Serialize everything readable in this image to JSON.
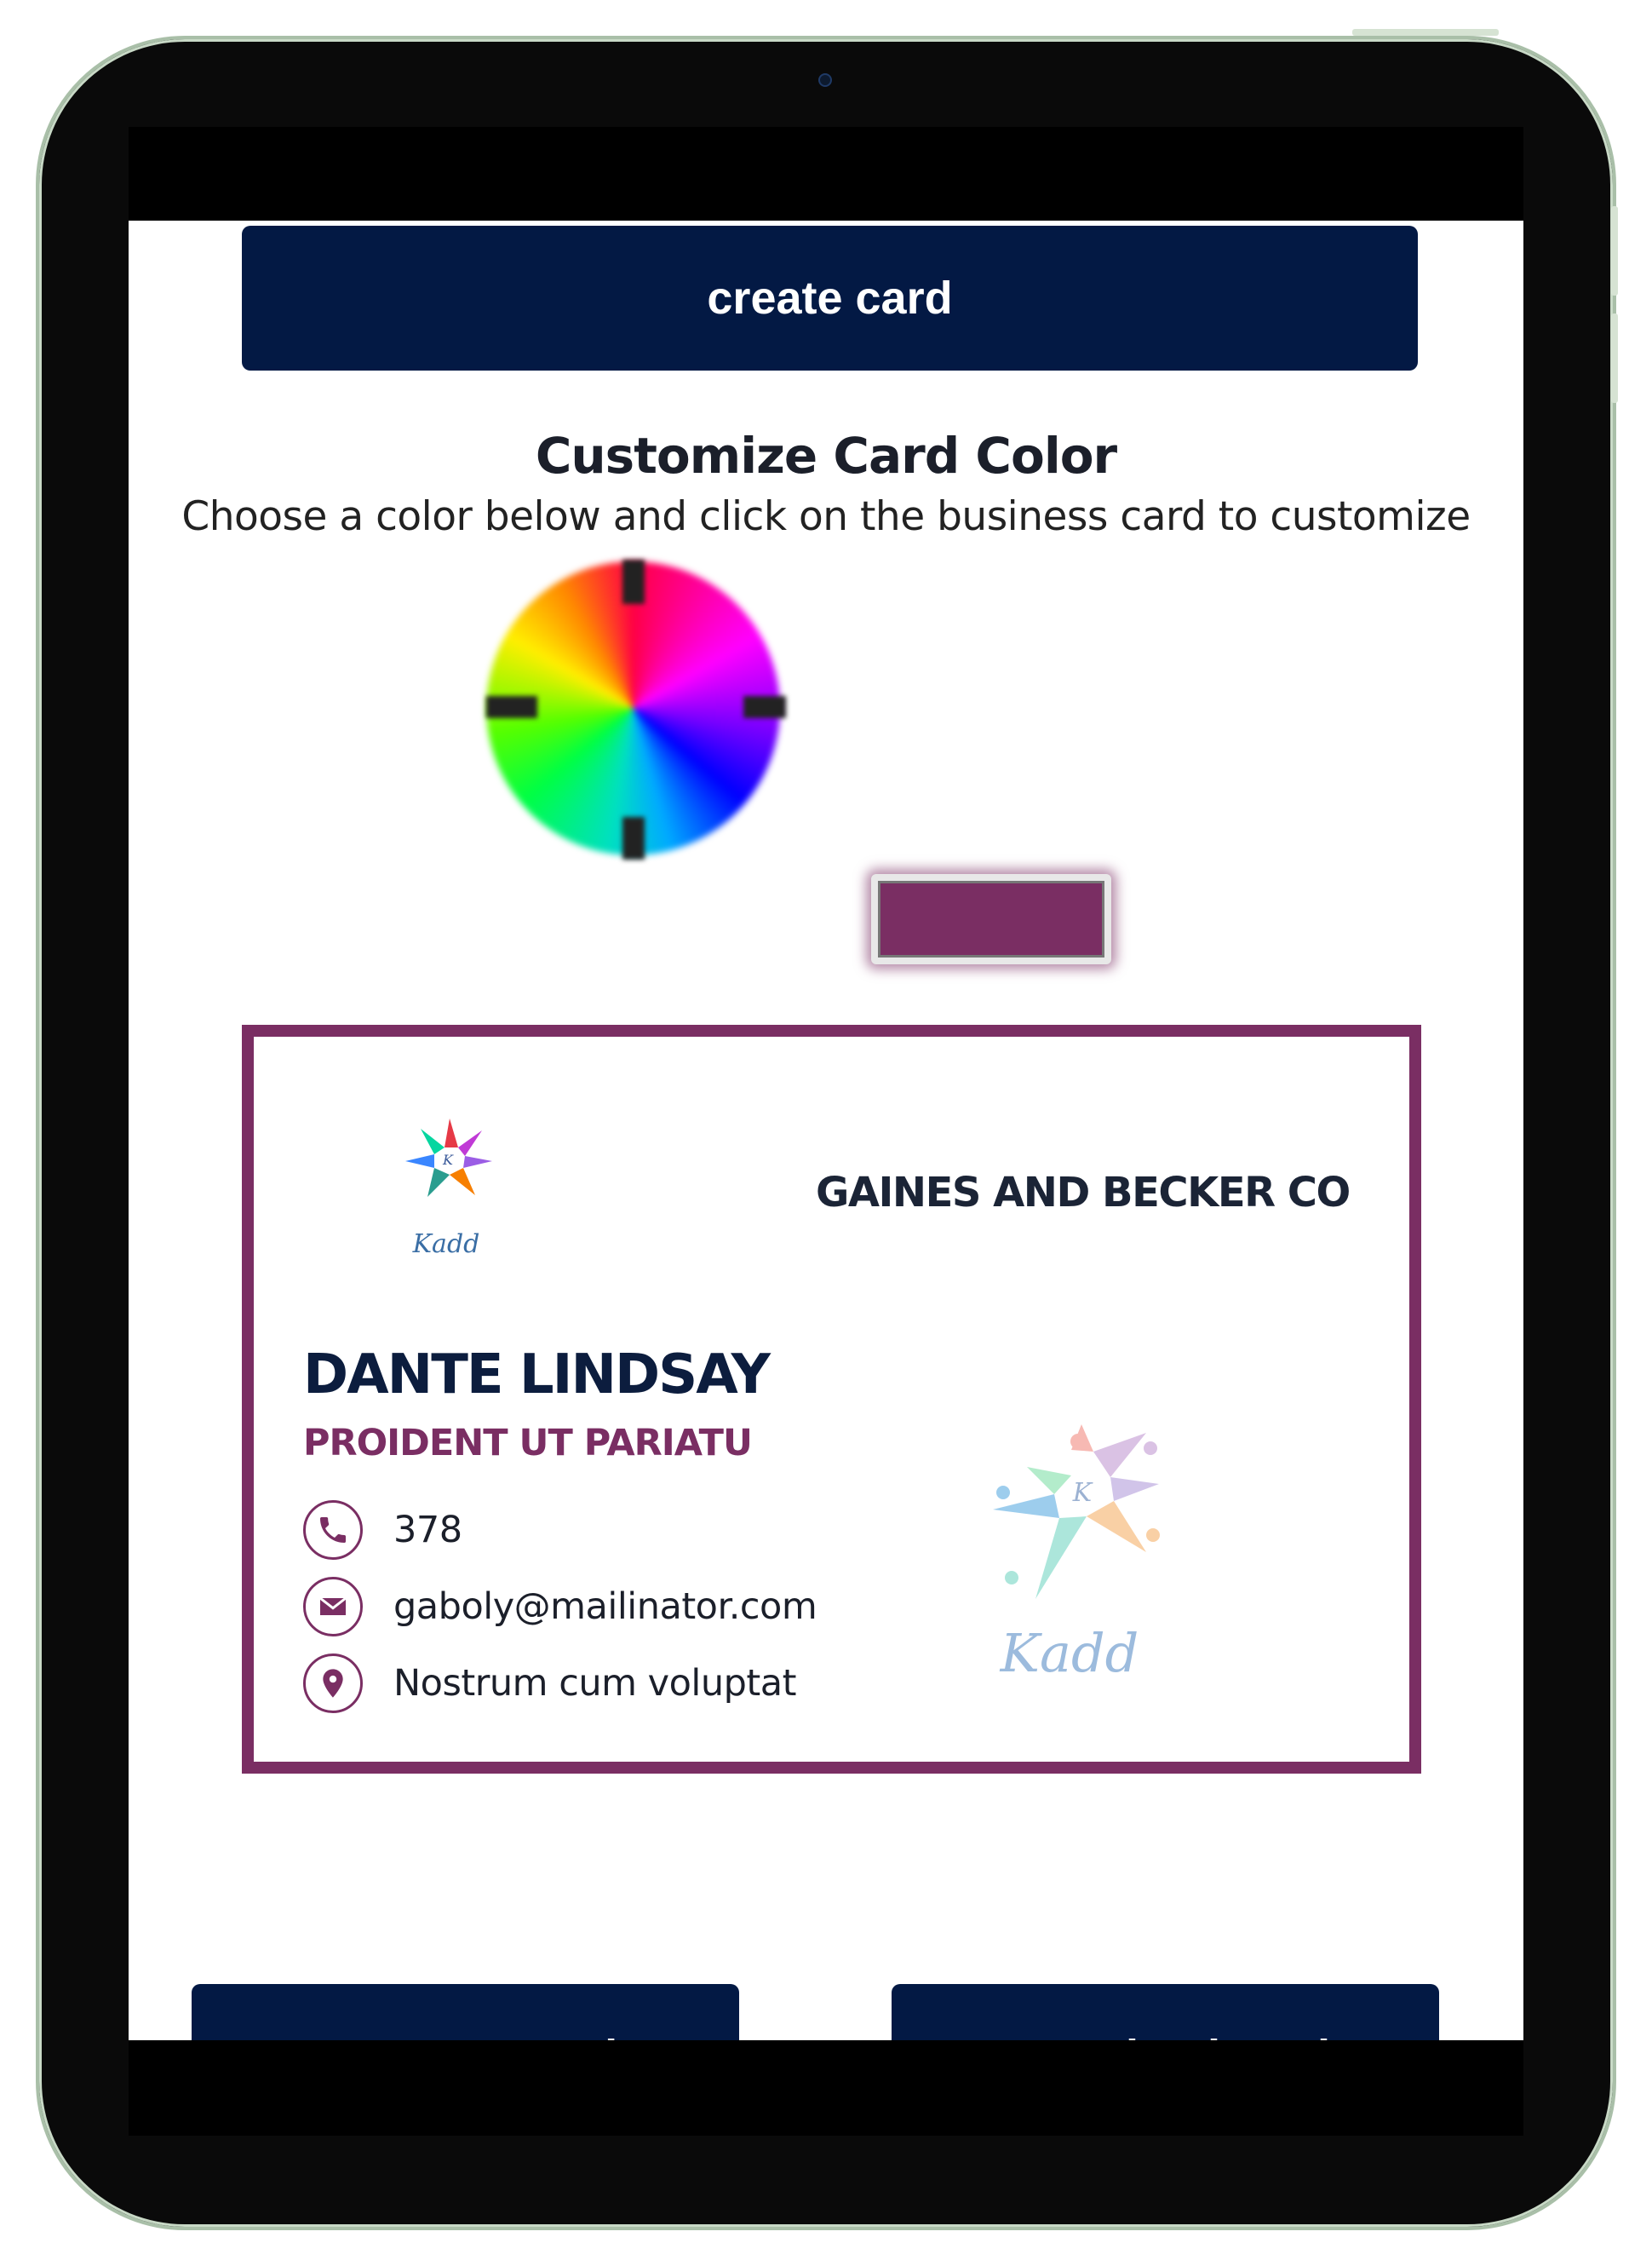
{
  "toolbar": {
    "create_label": "create card",
    "recreate_label": "Recreate card",
    "download_label": "Download card"
  },
  "customize": {
    "title": "Customize Card Color",
    "subtitle": "Choose a color below and click on the business card to customize",
    "selected_color": "#7a2e63"
  },
  "card": {
    "company": "GAINES AND BECKER CO",
    "name": "DANTE LINDSAY",
    "title": "PROIDENT UT PARIATU",
    "phone": "378",
    "email": "gaboly@mailinator.com",
    "address": "Nostrum cum voluptat",
    "logo_text": "Kadd"
  },
  "colors": {
    "button_bg": "#031944",
    "card_accent": "#7a2e63",
    "name_color": "#0c1d3e"
  },
  "icons": [
    "phone-icon",
    "mail-icon",
    "location-pin-icon",
    "kadd-logo"
  ]
}
